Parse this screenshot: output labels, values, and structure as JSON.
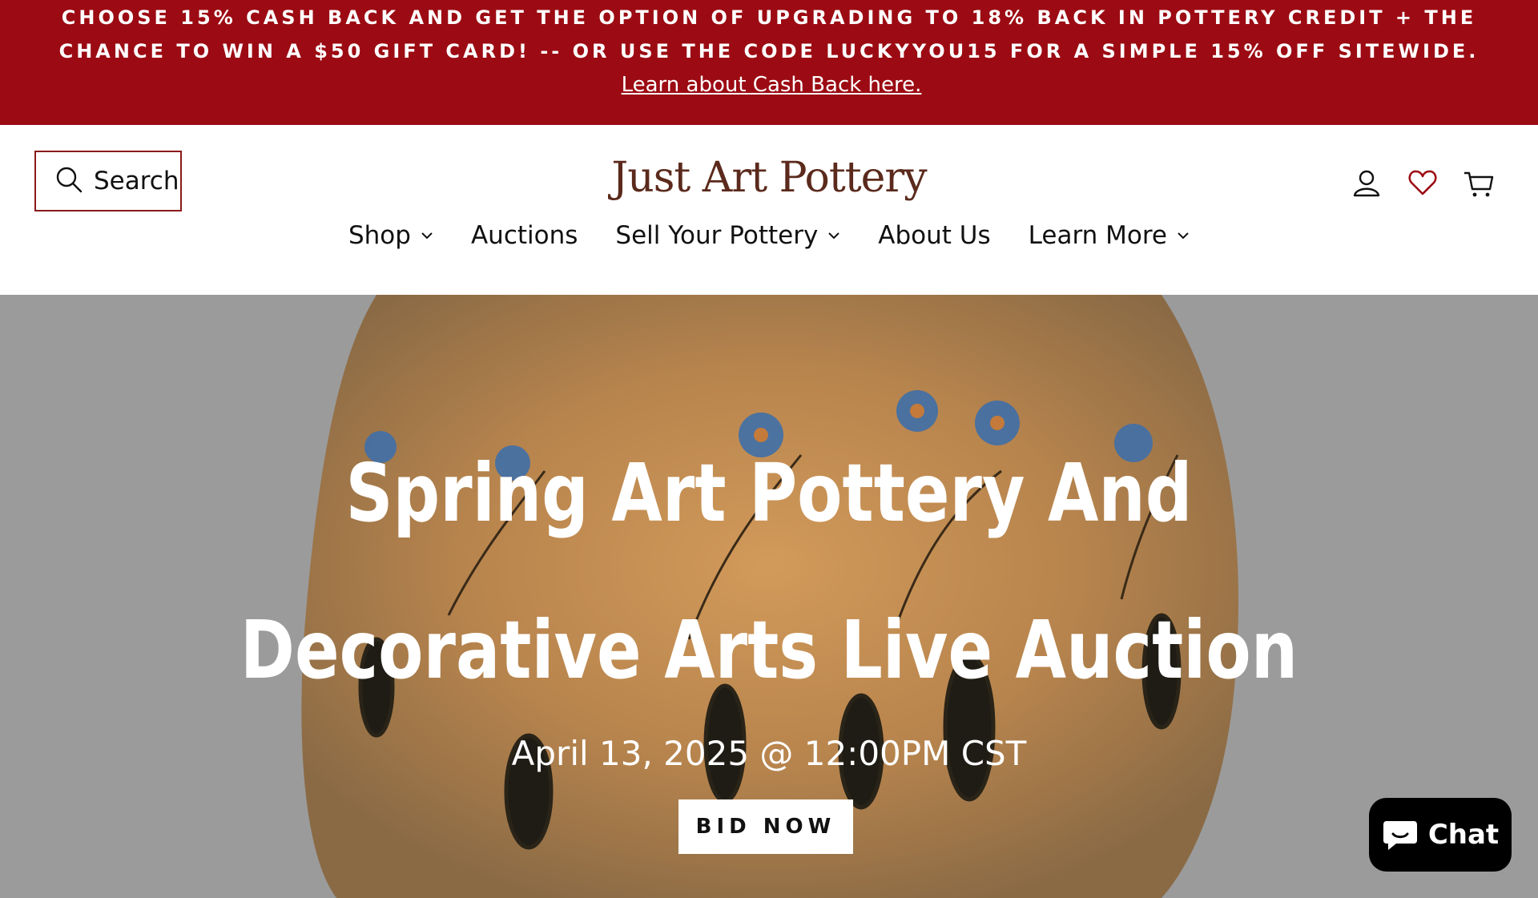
{
  "announcement": {
    "text": "CHOOSE 15% CASH BACK AND GET THE OPTION OF UPGRADING TO 18% BACK IN POTTERY CREDIT + THE CHANCE TO WIN A $50 GIFT CARD! -- OR USE THE CODE LUCKYYOU15 FOR A SIMPLE 15% OFF SITEWIDE.",
    "link_label": "Learn about Cash Back here."
  },
  "header": {
    "search_label": "Search",
    "logo": "Just Art Pottery",
    "icons": [
      "user-icon",
      "heart-icon",
      "cart-icon"
    ]
  },
  "nav": {
    "items": [
      {
        "label": "Shop",
        "has_dropdown": true
      },
      {
        "label": "Auctions",
        "has_dropdown": false
      },
      {
        "label": "Sell Your Pottery",
        "has_dropdown": true
      },
      {
        "label": "About Us",
        "has_dropdown": false
      },
      {
        "label": "Learn More",
        "has_dropdown": true
      }
    ]
  },
  "hero": {
    "title": "Spring Art Pottery And Decorative Arts Live Auction",
    "date": "April 13, 2025 @ 12:00PM CST",
    "button_label": "BID NOW"
  },
  "chat": {
    "label": "Chat"
  },
  "colors": {
    "announcement_bg": "#9c0b13",
    "logo": "#5b2a1c",
    "hero_bg": "#9b9b9b"
  }
}
